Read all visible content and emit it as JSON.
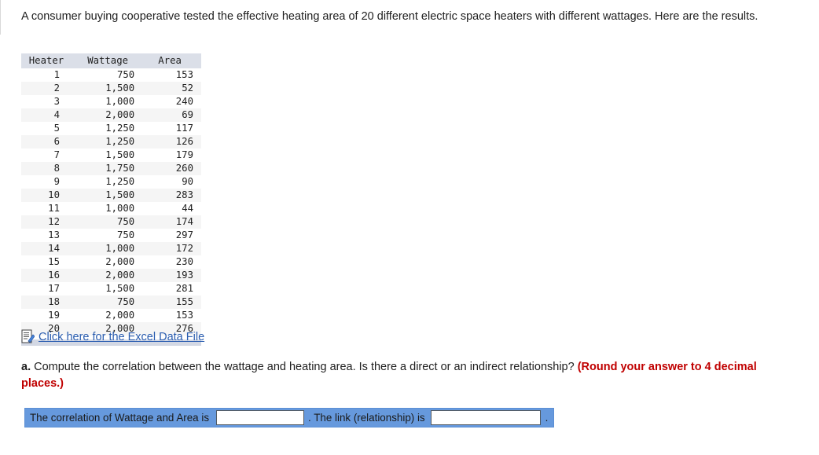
{
  "intro": {
    "text": "A consumer buying cooperative tested the effective heating area of 20 different electric space heaters with different wattages. Here are the results."
  },
  "table": {
    "columns": [
      "Heater",
      "Wattage",
      "Area"
    ],
    "rows": [
      [
        "1",
        "750",
        "153"
      ],
      [
        "2",
        "1,500",
        "52"
      ],
      [
        "3",
        "1,000",
        "240"
      ],
      [
        "4",
        "2,000",
        "69"
      ],
      [
        "5",
        "1,250",
        "117"
      ],
      [
        "6",
        "1,250",
        "126"
      ],
      [
        "7",
        "1,500",
        "179"
      ],
      [
        "8",
        "1,750",
        "260"
      ],
      [
        "9",
        "1,250",
        "90"
      ],
      [
        "10",
        "1,500",
        "283"
      ],
      [
        "11",
        "1,000",
        "44"
      ],
      [
        "12",
        "750",
        "174"
      ],
      [
        "13",
        "750",
        "297"
      ],
      [
        "14",
        "1,000",
        "172"
      ],
      [
        "15",
        "2,000",
        "230"
      ],
      [
        "16",
        "2,000",
        "193"
      ],
      [
        "17",
        "1,500",
        "281"
      ],
      [
        "18",
        "750",
        "155"
      ],
      [
        "19",
        "2,000",
        "153"
      ],
      [
        "20",
        "2,000",
        "276"
      ]
    ]
  },
  "excel_link": {
    "icon": "excel-document-icon",
    "label": "Click here for the Excel Data File"
  },
  "question": {
    "label": "a.",
    "body": "Compute the correlation between the wattage and heating area. Is there a direct or an indirect relationship?",
    "note": "(Round your answer to 4 decimal places.)"
  },
  "answer_bar": {
    "label_1": "The correlation of Wattage and Area is",
    "input_1_value": "",
    "input_1_placeholder": "",
    "separator": ". The link (relationship) is",
    "input_2_value": "",
    "input_2_placeholder": "",
    "end_punctuation": "."
  },
  "colors": {
    "answer_bar_blue": "#6699dd",
    "link_blue": "#2a5db0",
    "note_red": "#c00000",
    "table_header_bg": "#dbdfe8",
    "table_alt_row_bg": "#f5f5f5",
    "table_footer_bg": "#d3d8e4"
  }
}
